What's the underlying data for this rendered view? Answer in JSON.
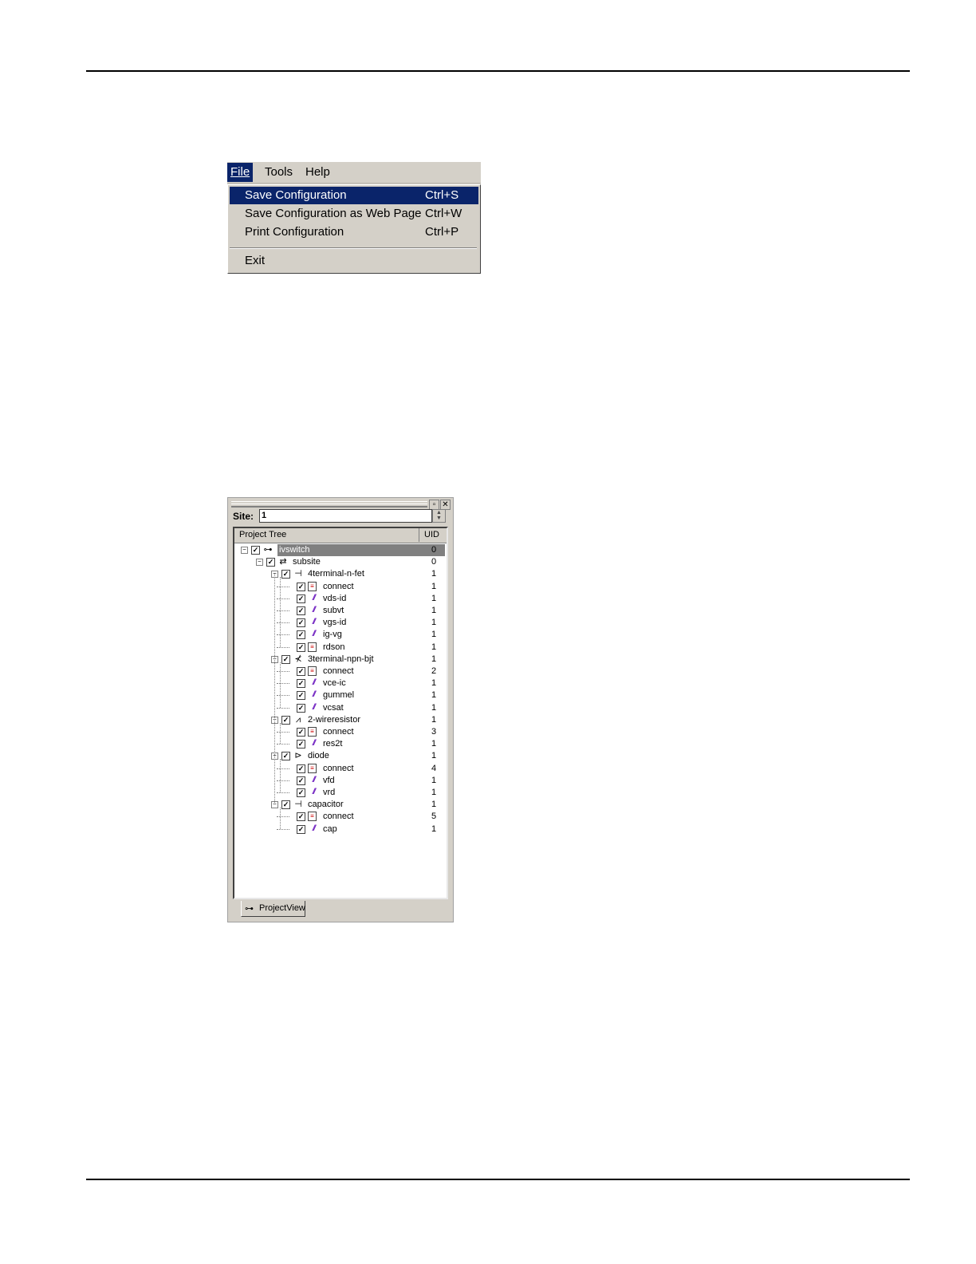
{
  "menu": {
    "menubar": [
      {
        "label": "File",
        "active": true
      },
      {
        "label": "Tools",
        "active": false
      },
      {
        "label": "Help",
        "active": false
      }
    ],
    "items": [
      {
        "label": "Save Configuration",
        "shortcut": "Ctrl+S",
        "highlighted": true
      },
      {
        "label": "Save Configuration as Web Page",
        "shortcut": "Ctrl+W",
        "highlighted": false
      },
      {
        "label": "Print Configuration",
        "shortcut": "Ctrl+P",
        "highlighted": false
      },
      {
        "label": "Exit",
        "shortcut": "",
        "highlighted": false
      }
    ],
    "highlight_color": "#0a246a"
  },
  "project_view": {
    "site_label": "Site:",
    "site_value": "1",
    "columns": {
      "tree": "Project Tree",
      "uid": "UID"
    },
    "tab_label": "ProjectView",
    "selected_node": "ivswitch",
    "nodes": [
      {
        "label": "ivswitch",
        "uid": "0",
        "depth": 0,
        "icon": "project-icon",
        "expanded": true
      },
      {
        "label": "subsite",
        "uid": "0",
        "depth": 1,
        "icon": "subsite-icon",
        "expanded": true
      },
      {
        "label": "4terminal-n-fet",
        "uid": "1",
        "depth": 2,
        "icon": "fet-icon",
        "expanded": true
      },
      {
        "label": "connect",
        "uid": "1",
        "depth": 3,
        "icon": "connect-test-icon"
      },
      {
        "label": "vds-id",
        "uid": "1",
        "depth": 3,
        "icon": "plot-test-icon"
      },
      {
        "label": "subvt",
        "uid": "1",
        "depth": 3,
        "icon": "plot-test-icon"
      },
      {
        "label": "vgs-id",
        "uid": "1",
        "depth": 3,
        "icon": "plot-test-icon"
      },
      {
        "label": "ig-vg",
        "uid": "1",
        "depth": 3,
        "icon": "plot-test-icon"
      },
      {
        "label": "rdson",
        "uid": "1",
        "depth": 3,
        "icon": "connect-test-icon"
      },
      {
        "label": "3terminal-npn-bjt",
        "uid": "1",
        "depth": 2,
        "icon": "bjt-icon",
        "expanded": true
      },
      {
        "label": "connect",
        "uid": "2",
        "depth": 3,
        "icon": "connect-test-icon"
      },
      {
        "label": "vce-ic",
        "uid": "1",
        "depth": 3,
        "icon": "plot-test-icon"
      },
      {
        "label": "gummel",
        "uid": "1",
        "depth": 3,
        "icon": "plot-test-icon"
      },
      {
        "label": "vcsat",
        "uid": "1",
        "depth": 3,
        "icon": "plot-test-icon"
      },
      {
        "label": "2-wireresistor",
        "uid": "1",
        "depth": 2,
        "icon": "resistor-icon",
        "expanded": true
      },
      {
        "label": "connect",
        "uid": "3",
        "depth": 3,
        "icon": "connect-test-icon"
      },
      {
        "label": "res2t",
        "uid": "1",
        "depth": 3,
        "icon": "plot-test-icon"
      },
      {
        "label": "diode",
        "uid": "1",
        "depth": 2,
        "icon": "diode-icon",
        "expanded": true
      },
      {
        "label": "connect",
        "uid": "4",
        "depth": 3,
        "icon": "connect-test-icon"
      },
      {
        "label": "vfd",
        "uid": "1",
        "depth": 3,
        "icon": "plot-test-icon"
      },
      {
        "label": "vrd",
        "uid": "1",
        "depth": 3,
        "icon": "plot-test-icon"
      },
      {
        "label": "capacitor",
        "uid": "1",
        "depth": 2,
        "icon": "capacitor-icon",
        "expanded": true
      },
      {
        "label": "connect",
        "uid": "5",
        "depth": 3,
        "icon": "connect-test-icon"
      },
      {
        "label": "cap",
        "uid": "1",
        "depth": 3,
        "icon": "plot-test-icon"
      }
    ]
  }
}
